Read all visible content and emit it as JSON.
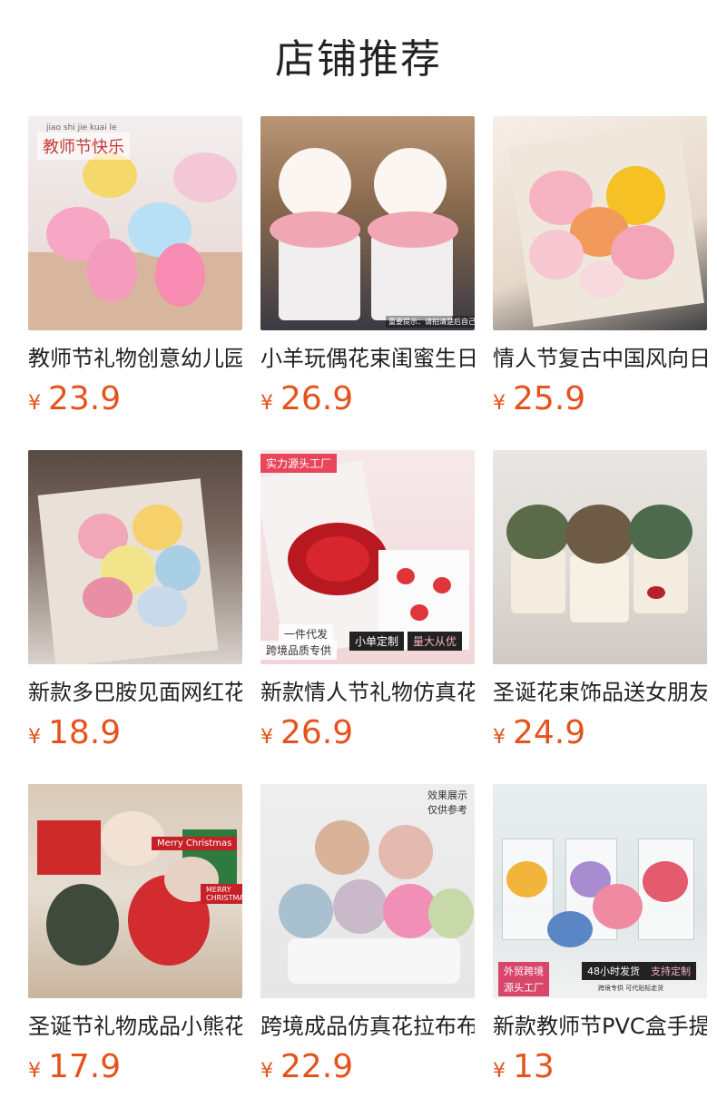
{
  "header": {
    "title": "店铺推荐"
  },
  "products": [
    {
      "name": "教师节礼物创意幼儿园",
      "currency": "¥",
      "price": "23.9",
      "overlay": [
        "jiao shi jie kuai le",
        "教师节快乐"
      ]
    },
    {
      "name": "小羊玩偶花束闺蜜生日",
      "currency": "¥",
      "price": "26.9",
      "overlay": [
        "重要提示：请拍清楚后自己打造"
      ]
    },
    {
      "name": "情人节复古中国风向日葵",
      "currency": "¥",
      "price": "25.9",
      "overlay": []
    },
    {
      "name": "新款多巴胺见面网红花束",
      "currency": "¥",
      "price": "18.9",
      "overlay": []
    },
    {
      "name": "新款情人节礼物仿真花束",
      "currency": "¥",
      "price": "26.9",
      "overlay": [
        "实力源头工厂",
        "一件代发",
        "跨境品质专供",
        "小单定制",
        "量大从优"
      ]
    },
    {
      "name": "圣诞花束饰品送女朋友",
      "currency": "¥",
      "price": "24.9",
      "overlay": []
    },
    {
      "name": "圣诞节礼物成品小熊花束",
      "currency": "¥",
      "price": "17.9",
      "overlay": [
        "Merry Christmas",
        "MERRY CHRISTMAS"
      ]
    },
    {
      "name": "跨境成品仿真花拉布布花束",
      "currency": "¥",
      "price": "22.9",
      "overlay": [
        "效果展示",
        "仅供参考"
      ]
    },
    {
      "name": "新款教师节PVC盒手提花束",
      "currency": "¥",
      "price": "13",
      "overlay": [
        "外贸跨境",
        "源头工厂",
        "48小时发货",
        "支持定制",
        "跨境专供 可代贴标走货"
      ]
    }
  ],
  "colors": {
    "price": "#e4531d",
    "text": "#222222",
    "background": "#ffffff"
  }
}
